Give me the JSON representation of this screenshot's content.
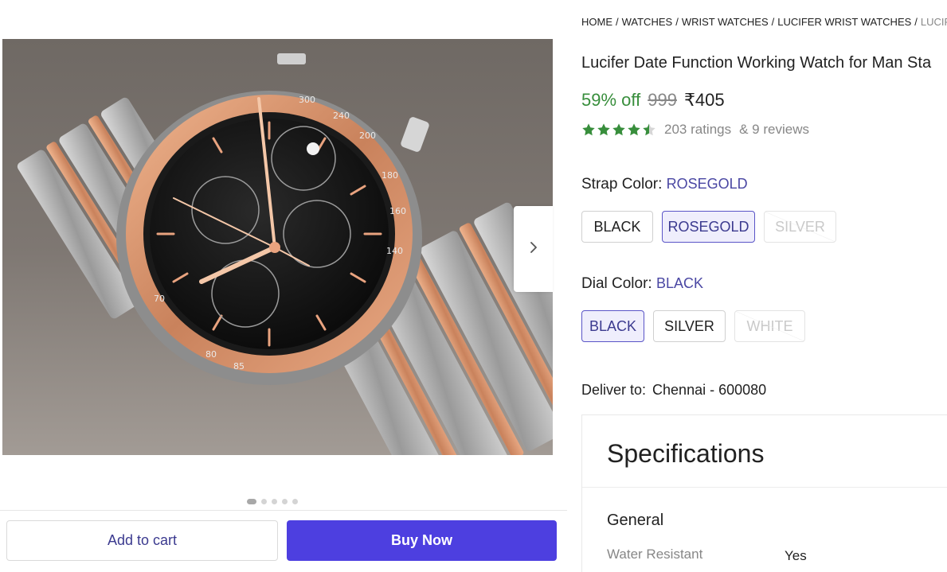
{
  "breadcrumb": {
    "items": [
      "HOME",
      "WATCHES",
      "WRIST WATCHES",
      "LUCIFER WRIST WATCHES"
    ],
    "current": "LUCIFER"
  },
  "product": {
    "title": "Lucifer Date Function Working Watch for Man Sta",
    "discount": "59% off",
    "mrp": "999",
    "price": "₹405",
    "rating_stars": 4.5,
    "ratings_text": "203 ratings",
    "reviews_text": "& 9 reviews"
  },
  "gallery": {
    "image_count": 5,
    "active_index": 0,
    "next_icon": "chevron-right-icon"
  },
  "strap": {
    "label": "Strap Color:",
    "selected": "ROSEGOLD",
    "options": [
      {
        "label": "BLACK",
        "state": "normal"
      },
      {
        "label": "ROSEGOLD",
        "state": "selected"
      },
      {
        "label": "SILVER",
        "state": "disabled"
      }
    ]
  },
  "dial": {
    "label": "Dial Color:",
    "selected": "BLACK",
    "options": [
      {
        "label": "BLACK",
        "state": "selected"
      },
      {
        "label": "SILVER",
        "state": "normal"
      },
      {
        "label": "WHITE",
        "state": "disabled"
      }
    ]
  },
  "delivery": {
    "label": "Deliver to:",
    "location": "Chennai - 600080"
  },
  "specifications": {
    "title": "Specifications",
    "group": "General",
    "rows": [
      {
        "key": "Water Resistant",
        "value": "Yes"
      }
    ]
  },
  "actions": {
    "add_to_cart": "Add to cart",
    "buy_now": "Buy Now"
  },
  "colors": {
    "accent": "#4d3fe0",
    "discount_green": "#388e3c",
    "star_green": "#388e3c",
    "selected_text": "#4a47a3"
  }
}
